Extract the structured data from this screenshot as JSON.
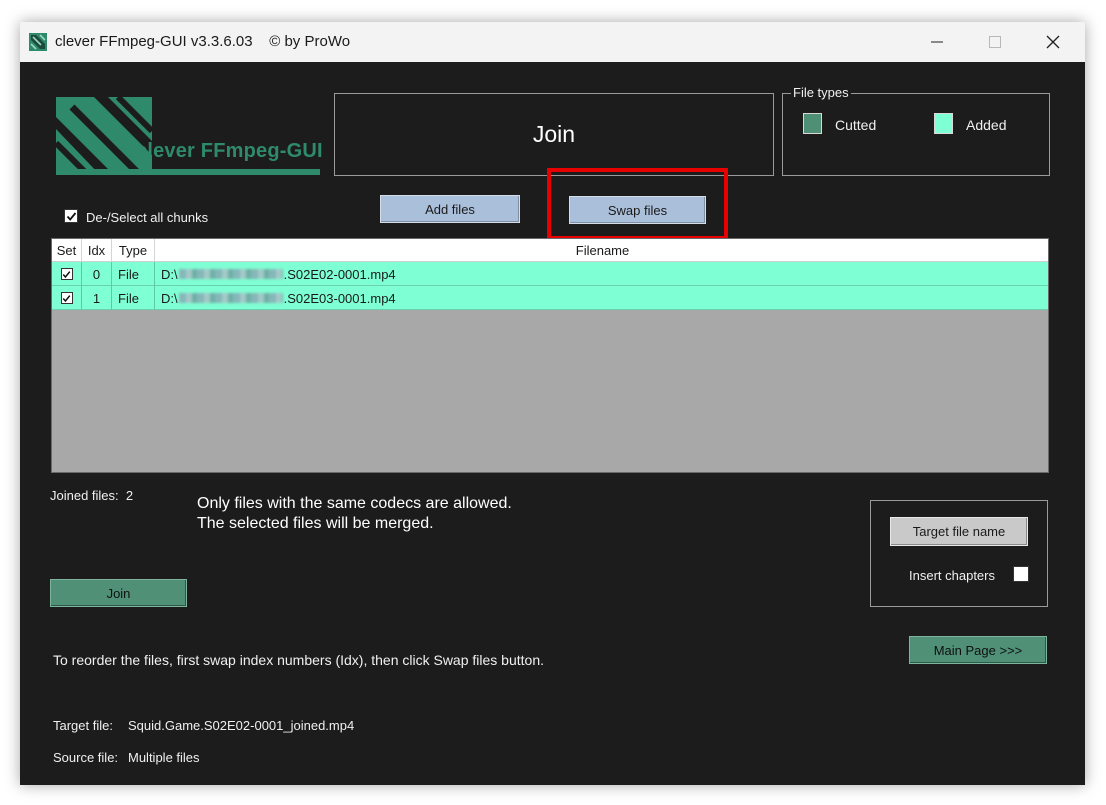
{
  "window": {
    "title": "clever FFmpeg-GUI v3.3.6.03    © by ProWo"
  },
  "logo": {
    "text": "clever FFmpeg-GUI"
  },
  "header": {
    "mode_title": "Join"
  },
  "file_types": {
    "legend": "File types",
    "items": [
      {
        "label": "Cutted",
        "color": "#4f8f76"
      },
      {
        "label": "Added",
        "color": "#7fffd4"
      }
    ]
  },
  "toolbar": {
    "select_all_label": "De-/Select all chunks",
    "select_all_checked": true,
    "add_files_label": "Add files",
    "swap_files_label": "Swap files"
  },
  "table": {
    "columns": [
      "Set",
      "Idx",
      "Type",
      "Filename"
    ],
    "rows": [
      {
        "set": true,
        "idx": "0",
        "type": "File",
        "prefix": "D:\\",
        "suffix": ".S02E02-0001.mp4"
      },
      {
        "set": true,
        "idx": "1",
        "type": "File",
        "prefix": "D:\\",
        "suffix": ".S02E03-0001.mp4"
      }
    ]
  },
  "status": {
    "joined_label": "Joined files:",
    "joined_count": "2",
    "note_line1": "Only files with the same codecs are allowed.",
    "note_line2": "The selected files will be merged.",
    "reorder_hint": "To reorder the files, first swap index numbers (Idx), then click Swap files button."
  },
  "actions": {
    "join_label": "Join",
    "target_name_label": "Target file name",
    "insert_chapters_label": "Insert chapters",
    "main_page_label": "Main Page >>>"
  },
  "files": {
    "target_label": "Target file:",
    "target_value": "Squid.Game.S02E02-0001_joined.mp4",
    "source_label": "Source file:",
    "source_value": "Multiple files"
  },
  "colors": {
    "background": "#1c1c1c",
    "row_added": "#7fffd4",
    "button_blue": "#aabfd9",
    "button_green": "#4f9077",
    "highlight": "#e60000"
  }
}
